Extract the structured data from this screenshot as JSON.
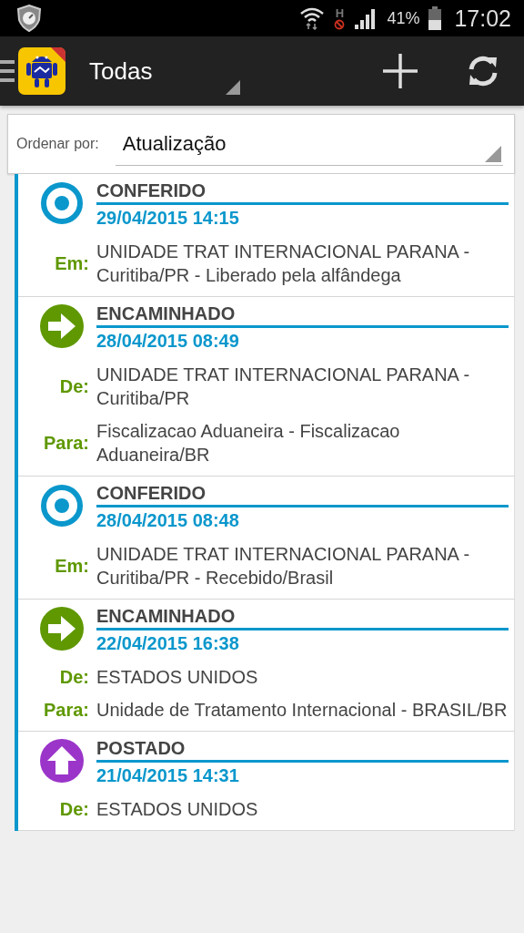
{
  "status_bar": {
    "network_type": "H",
    "battery": "41%",
    "time": "17:02"
  },
  "app_bar": {
    "title": "Todas"
  },
  "sort": {
    "label": "Ordenar por:",
    "value": "Atualização"
  },
  "events": [
    {
      "kind": "checked",
      "status": "CONFERIDO",
      "datetime": "29/04/2015 14:15",
      "details": [
        {
          "label": "Em:",
          "text": "UNIDADE TRAT INTERNACIONAL PARANA - Curitiba/PR - Liberado pela alfândega"
        }
      ]
    },
    {
      "kind": "forwarded",
      "status": "ENCAMINHADO",
      "datetime": "28/04/2015 08:49",
      "details": [
        {
          "label": "De:",
          "text": "UNIDADE TRAT INTERNACIONAL PARANA - Curitiba/PR"
        },
        {
          "label": "Para:",
          "text": "Fiscalizacao Aduaneira - Fiscalizacao Aduaneira/BR"
        }
      ]
    },
    {
      "kind": "checked",
      "status": "CONFERIDO",
      "datetime": "28/04/2015 08:48",
      "details": [
        {
          "label": "Em:",
          "text": "UNIDADE TRAT INTERNACIONAL PARANA - Curitiba/PR - Recebido/Brasil"
        }
      ]
    },
    {
      "kind": "forwarded",
      "status": "ENCAMINHADO",
      "datetime": "22/04/2015 16:38",
      "details": [
        {
          "label": "De:",
          "text": "ESTADOS UNIDOS"
        },
        {
          "label": "Para:",
          "text": "Unidade de Tratamento Internacional - BRASIL/BR"
        }
      ]
    },
    {
      "kind": "posted",
      "status": "POSTADO",
      "datetime": "21/04/2015 14:31",
      "details": [
        {
          "label": "De:",
          "text": "ESTADOS UNIDOS"
        }
      ]
    }
  ]
}
